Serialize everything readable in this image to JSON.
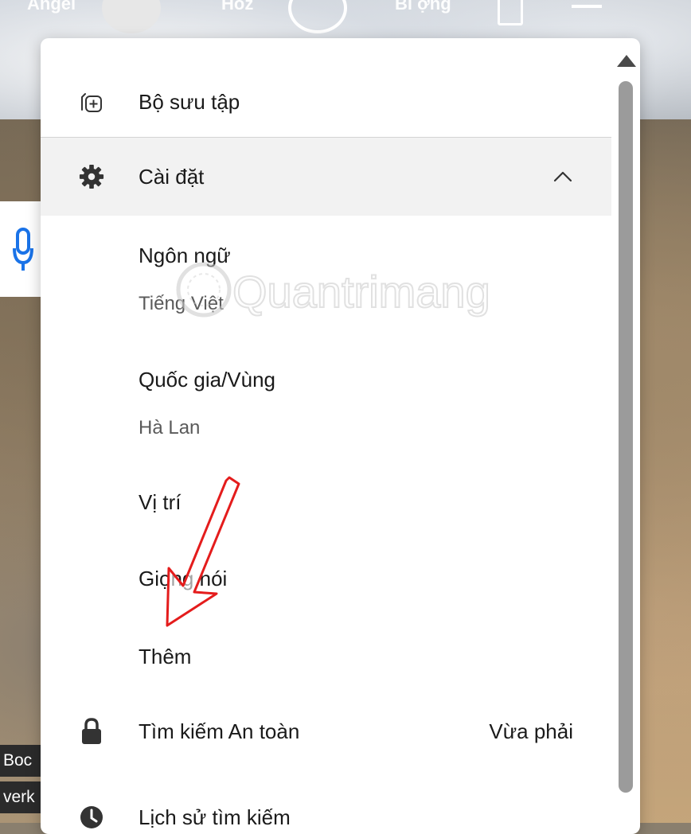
{
  "top_bar": {
    "item1": "Angel",
    "item2": "Hoz",
    "item3": "Bi ợng"
  },
  "side_captions": [
    "Boc",
    "verk"
  ],
  "menu": {
    "collection_label": "Bộ sưu tập",
    "settings_label": "Cài đặt",
    "settings_expanded": true,
    "settings_sub": {
      "language_title": "Ngôn ngữ",
      "language_value": "Tiếng Việt",
      "region_title": "Quốc gia/Vùng",
      "region_value": "Hà Lan",
      "location_title": "Vị trí",
      "voice_title": "Giọng nói",
      "more_title": "Thêm"
    },
    "safesearch_label": "Tìm kiếm An toàn",
    "safesearch_value": "Vừa phải",
    "history_label": "Lịch sử tìm kiếm"
  },
  "watermark_text": "Quantrimang",
  "colors": {
    "panel_bg": "#ffffff",
    "settings_highlight": "#f2f2f2",
    "annotation_red": "#e41c1c",
    "mic_blue": "#1a73e8"
  },
  "icons": {
    "collection": "collection-add-icon",
    "settings": "gear-icon",
    "chevron": "chevron-up-icon",
    "safesearch": "lock-icon",
    "history": "clock-icon"
  }
}
